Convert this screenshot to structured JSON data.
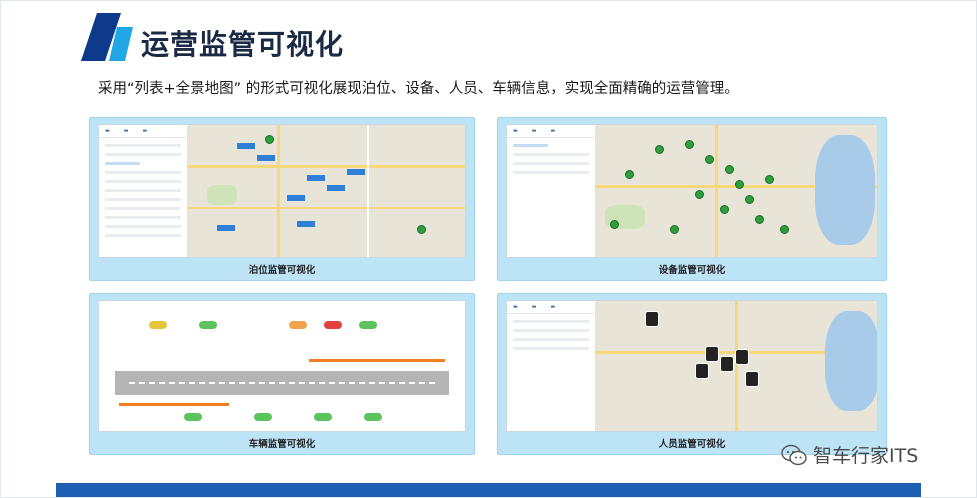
{
  "header": {
    "title": "运营监管可视化",
    "subtitle": "采用“列表+全景地图” 的形式可视化展现泊位、设备、人员、车辆信息，实现全面精确的运营管理。"
  },
  "panels": {
    "berth": {
      "caption": "泊位监管可视化"
    },
    "device": {
      "caption": "设备监管可视化"
    },
    "vehicle": {
      "caption": "车辆监管可视化"
    },
    "staff": {
      "caption": "人员监管可视化"
    }
  },
  "watermark": {
    "text": "智车行家ITS",
    "icon": "wechat-icon"
  },
  "colors": {
    "accent": "#1f5fb3",
    "logo_dark": "#0e3a8c",
    "logo_light": "#21a6e6",
    "panel_bg": "#bde3f7",
    "map_road": "#f6d77a",
    "marker_green": "#2f9e3c",
    "bar_orange": "#f57f20"
  }
}
